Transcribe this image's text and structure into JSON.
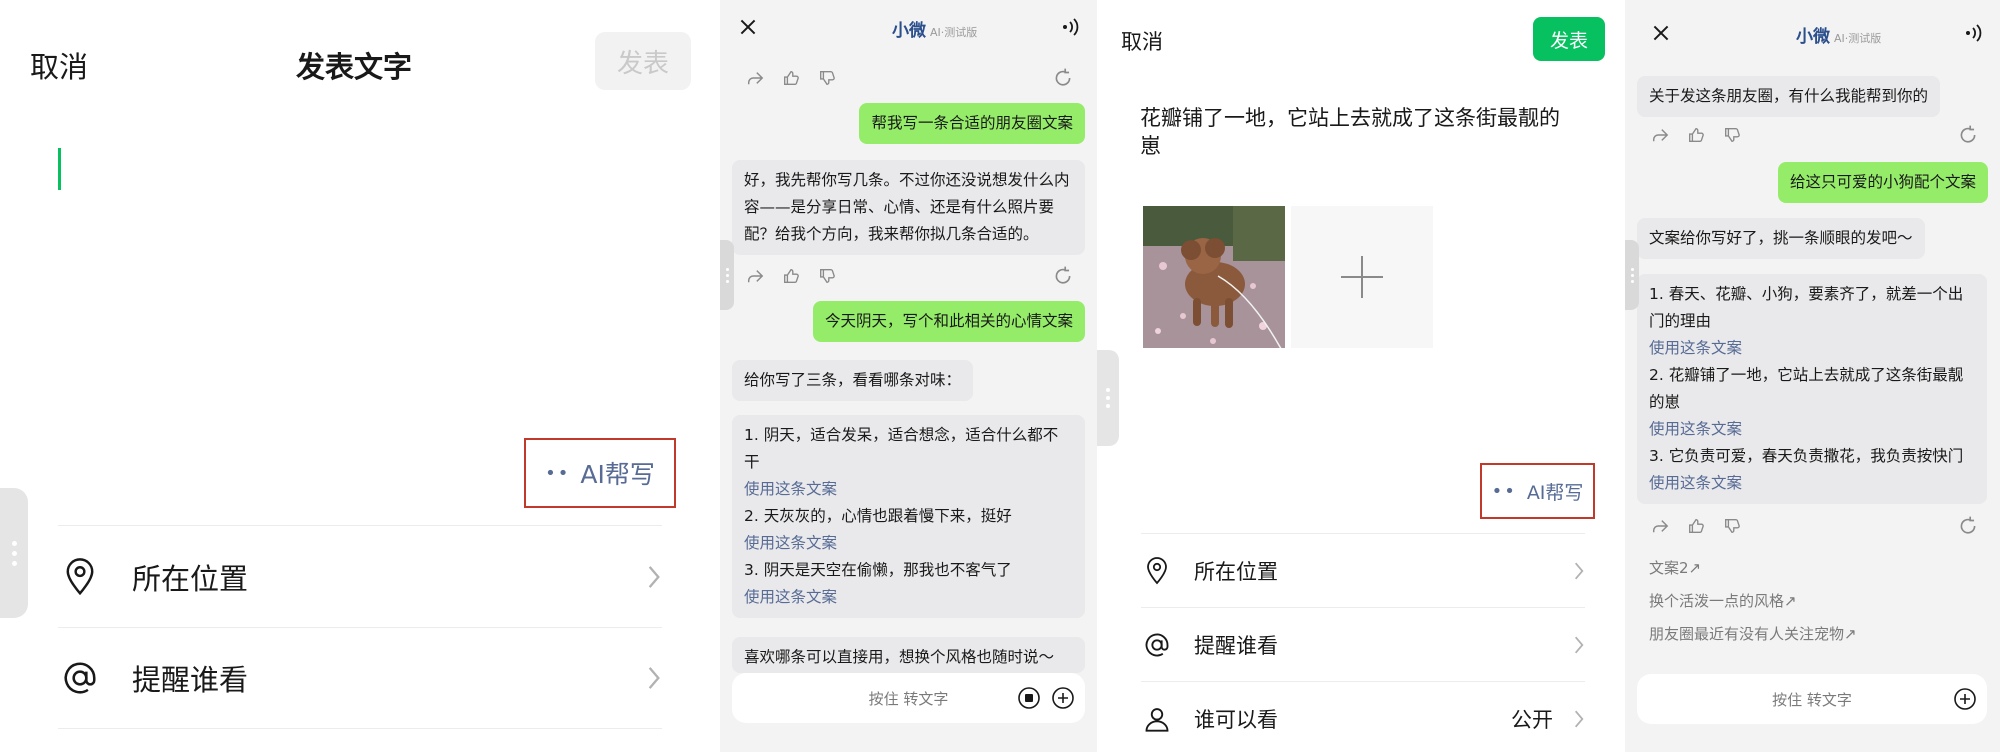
{
  "panel1": {
    "cancel": "取消",
    "title": "发表文字",
    "publish": "发表",
    "ai_help": "AI帮写",
    "rows": [
      {
        "label": "所在位置",
        "icon": "location-pin-icon"
      },
      {
        "label": "提醒谁看",
        "icon": "at-sign-icon"
      }
    ]
  },
  "panel2": {
    "title": "小微",
    "beta": "AI·测试版",
    "messages": {
      "user1": "帮我写一条合适的朋友圈文案",
      "ai1": "好，我先帮你写几条。不过你还没说想发什么内容——是分享日常、心情、还是有什么照片要配？给我个方向，我来帮你拟几条合适的。",
      "user2": "今天阴天，写个和此相关的心情文案",
      "ai2": "给你写了三条，看看哪条对味：",
      "options": [
        {
          "text": "1. 阴天，适合发呆，适合想念，适合什么都不干",
          "use": "使用这条文案"
        },
        {
          "text": "2. 天灰灰的，心情也跟着慢下来，挺好",
          "use": "使用这条文案"
        },
        {
          "text": "3. 阴天是天空在偷懒，那我也不客气了",
          "use": "使用这条文案"
        }
      ],
      "ai3": "喜欢哪条可以直接用，想换个风格也随时说～"
    },
    "input_placeholder": "按住 转文字"
  },
  "panel3": {
    "cancel": "取消",
    "publish": "发表",
    "post_text": "花瓣铺了一地，它站上去就成了这条街最靓的崽",
    "ai_help": "AI帮写",
    "rows": [
      {
        "label": "所在位置",
        "icon": "location-pin-icon",
        "value": ""
      },
      {
        "label": "提醒谁看",
        "icon": "at-sign-icon",
        "value": ""
      },
      {
        "label": "谁可以看",
        "icon": "person-icon",
        "value": "公开"
      }
    ]
  },
  "panel4": {
    "title": "小微",
    "beta": "AI·测试版",
    "messages": {
      "ai0": "关于发这条朋友圈，有什么我能帮到你的",
      "user1": "给这只可爱的小狗配个文案",
      "ai1": "文案给你写好了，挑一条顺眼的发吧～",
      "options": [
        {
          "text": "1. 春天、花瓣、小狗，要素齐了，就差一个出门的理由",
          "use": "使用这条文案"
        },
        {
          "text": "2. 花瓣铺了一地，它站上去就成了这条街最靓的崽",
          "use": "使用这条文案"
        },
        {
          "text": "3. 它负责可爱，春天负责撒花，我负责按快门",
          "use": "使用这条文案"
        }
      ]
    },
    "suggestions": [
      "文案2↗",
      "换个活泼一点的风格↗",
      "朋友圈最近有没有人关注宠物↗"
    ],
    "input_placeholder": "按住 转文字"
  },
  "colors": {
    "wechat_green": "#07c160",
    "bubble_green": "#95ec69",
    "link_blue": "#576b95",
    "highlight_red": "#c0392b"
  }
}
